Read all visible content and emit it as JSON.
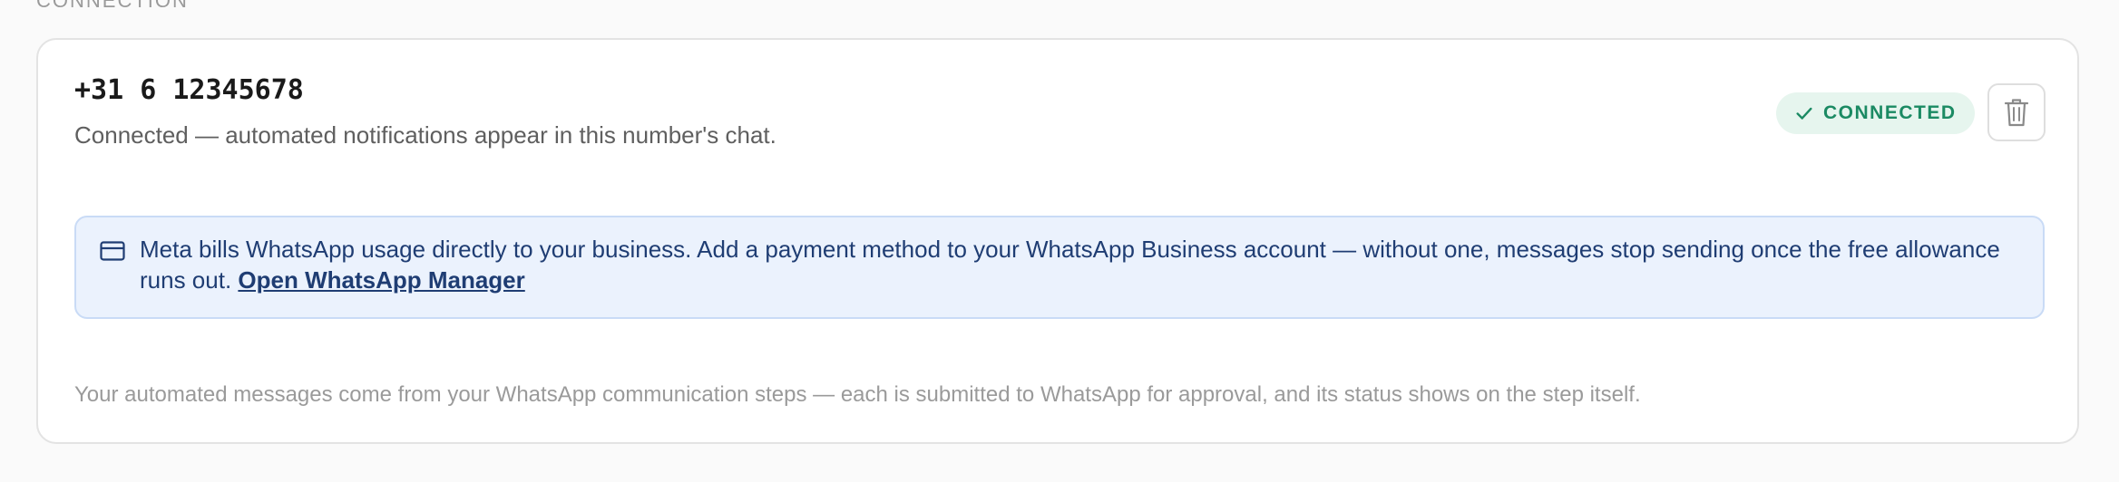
{
  "section": {
    "label": "CONNECTION"
  },
  "connection": {
    "phone": "+31 6 12345678",
    "subtitle": "Connected — automated notifications appear in this number's chat.",
    "status_badge": "CONNECTED",
    "status_icon": "check-icon",
    "delete_icon": "trash-icon"
  },
  "billing_notice": {
    "icon": "credit-card-icon",
    "text": "Meta bills WhatsApp usage directly to your business. Add a payment method to your WhatsApp Business account — without one, messages stop sending once the free allowance runs out.",
    "link_label": "Open WhatsApp Manager"
  },
  "footer_note": "Your automated messages come from your WhatsApp communication steps — each is submitted to WhatsApp for approval, and its status shows on the step itself.",
  "colors": {
    "badge_bg": "#e6f5ee",
    "badge_text": "#1b8a63",
    "notice_bg": "#ebf2fd",
    "notice_border": "#c9dbf6",
    "notice_text": "#1f3d73"
  }
}
